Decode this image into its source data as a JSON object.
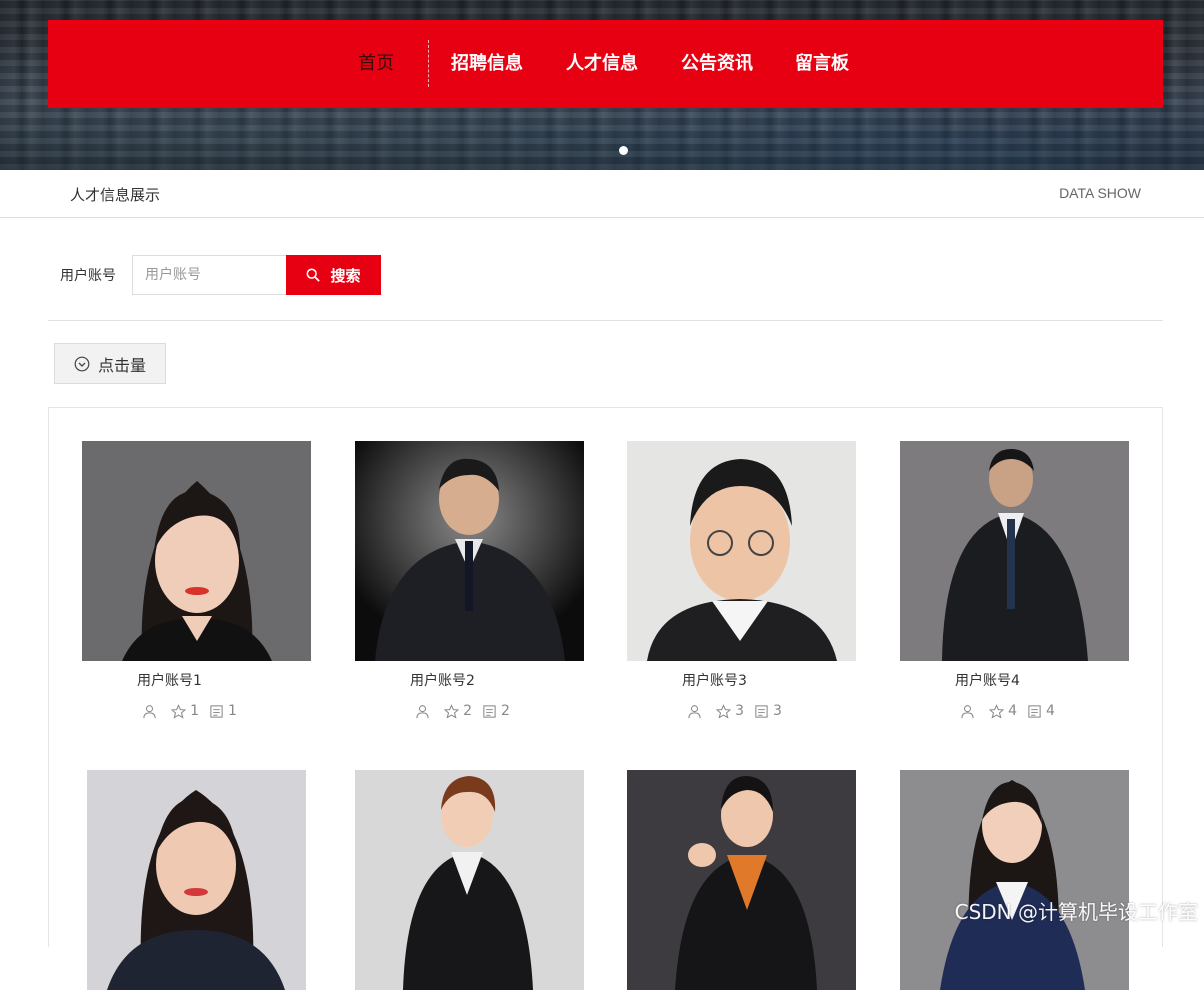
{
  "nav": {
    "items": [
      "首页",
      "招聘信息",
      "人才信息",
      "公告资讯",
      "留言板"
    ]
  },
  "section": {
    "title": "人才信息展示",
    "subtitle": "DATA SHOW"
  },
  "search": {
    "label": "用户账号",
    "placeholder": "用户账号",
    "button_label": "搜索"
  },
  "sort": {
    "label": "点击量"
  },
  "cards": [
    {
      "name": "用户账号1",
      "likes": "1",
      "views": "1"
    },
    {
      "name": "用户账号2",
      "likes": "2",
      "views": "2"
    },
    {
      "name": "用户账号3",
      "likes": "3",
      "views": "3"
    },
    {
      "name": "用户账号4",
      "likes": "4",
      "views": "4"
    },
    {
      "name": "",
      "likes": "",
      "views": ""
    },
    {
      "name": "",
      "likes": "",
      "views": ""
    },
    {
      "name": "",
      "likes": "",
      "views": ""
    },
    {
      "name": "",
      "likes": "",
      "views": ""
    }
  ],
  "watermark": "CSDN @计算机毕设工作室",
  "colors": {
    "accent": "#e60012"
  }
}
